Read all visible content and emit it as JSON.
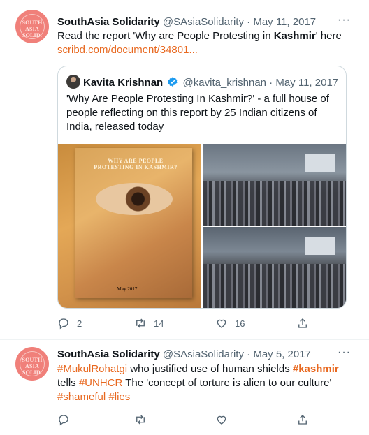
{
  "tweets": [
    {
      "name": "SouthAsia Solidarity",
      "handle": "@SAsiaSolidarity",
      "sep": "·",
      "date": "May 11, 2017",
      "more": "···",
      "avatar_text": "SOUTH\nASIA\nSOLIDARITY",
      "text_pre": "Read the report 'Why are People Protesting in ",
      "text_bold": "Kashmir",
      "text_post": "' here",
      "link": "scribd.com/document/34801...",
      "quote": {
        "name": "Kavita Krishnan",
        "handle": "@kavita_krishnan",
        "sep": "·",
        "date": "May 11, 2017",
        "text": "'Why Are People Protesting In Kashmir?' - a full house of people reflecting on this report by 25 Indian citizens of India, released today",
        "book_title": "WHY ARE PEOPLE PROTESTING IN KASHMIR?",
        "book_date": "May 2017"
      },
      "replies": "2",
      "retweets": "14",
      "likes": "16"
    },
    {
      "name": "SouthAsia Solidarity",
      "handle": "@SAsiaSolidarity",
      "sep": "·",
      "date": "May 5, 2017",
      "more": "···",
      "tag1": "#MukulRohatgi",
      "mid1": " who justified use of human shields ",
      "tag2": "#kashmir",
      "mid2": " tells ",
      "tag3": "#UNHCR",
      "mid3": " The 'concept of torture is alien to our culture' ",
      "tag4": "#shameful",
      "mid4": " ",
      "tag5": "#lies"
    }
  ],
  "colors": {
    "link": "#e8681f",
    "muted": "#536471",
    "border": "#cfd9de",
    "verified": "#1d9bf0"
  }
}
